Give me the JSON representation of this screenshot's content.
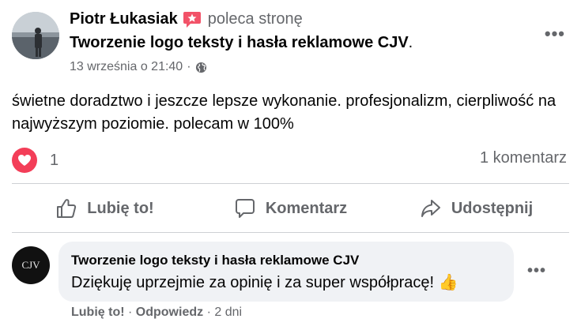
{
  "post": {
    "author": "Piotr Łukasiak",
    "recommends": "poleca stronę",
    "page_name": "Tworzenie logo teksty i hasła reklamowe CJV",
    "page_name_suffix": ".",
    "timestamp": "13 września o 21:40",
    "separator": "·",
    "privacy_icon": "globe-icon",
    "body": "świetne doradztwo i jeszcze lepsze wykonanie. profesjonalizm, cierpliwość na najwyższym poziomie. polecam w 100%",
    "reaction_icon": "heart-icon",
    "reaction_count": "1",
    "comment_count": "1 komentarz",
    "menu": "•••"
  },
  "actions": {
    "like": "Lubię to!",
    "comment": "Komentarz",
    "share": "Udostępnij"
  },
  "comment": {
    "avatar_text": "CJV",
    "author": "Tworzenie logo teksty i hasła reklamowe CJV",
    "text": "Dziękuję uprzejmie za opinię i za super współpracę! 👍",
    "like": "Lubię to!",
    "reply": "Odpowiedz",
    "age": "2 dni",
    "separator": "·",
    "menu": "•••"
  },
  "colors": {
    "secondary_text": "#65676b",
    "heart": "#f33e58",
    "divider": "#ced0d4",
    "bubble": "#f0f2f5"
  }
}
